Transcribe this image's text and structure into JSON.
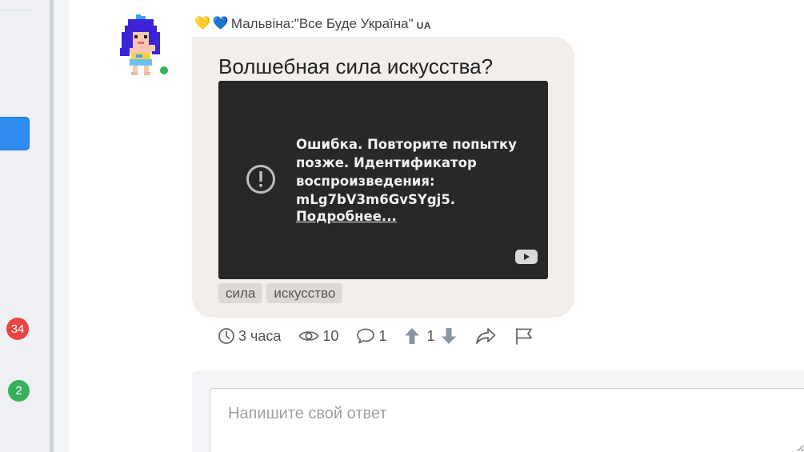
{
  "post": {
    "author_name": "Мальвіна:\"Все Буде Україна\"",
    "author_suffix": "UA",
    "author_hearts": [
      "💛",
      "💙"
    ],
    "title": "Волшебная сила искусства?",
    "video_error": {
      "message": "Ошибка. Повторите попытку позже. Идентификатор воспроизведения: mLg7bV3m6GvSYgj5.",
      "link_label": "Подробнее..."
    },
    "tags": [
      "сила",
      "искусство"
    ],
    "stats": {
      "time": "3 часа",
      "views": "10",
      "comments": "1",
      "votes": "1"
    }
  },
  "sidebar": {
    "badges": [
      "34",
      "2"
    ]
  },
  "reply": {
    "placeholder": "Напишите свой ответ"
  },
  "colors": {
    "accent_blue": "#2e8cf0",
    "badge_red": "#e84545",
    "badge_green": "#36b05a",
    "bubble_bg": "#f1eeeb",
    "video_bg": "#282828"
  },
  "icons": {
    "time": "clock-icon",
    "views": "eye-icon",
    "comments": "speech-bubble-icon",
    "upvote": "arrow-up-icon",
    "downvote": "arrow-down-icon",
    "share": "share-arrow-icon",
    "report": "flag-icon",
    "video_error": "alert-circle-icon",
    "youtube": "youtube-logo-icon"
  }
}
